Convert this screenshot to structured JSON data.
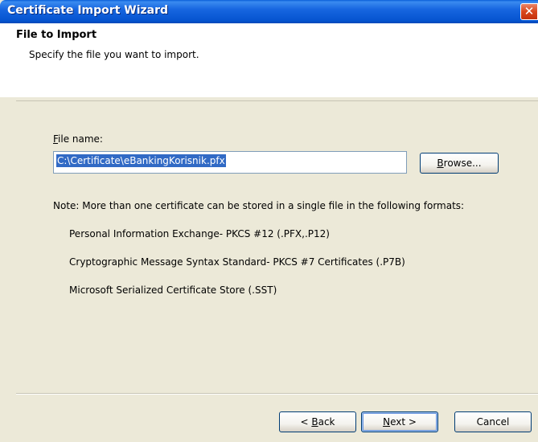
{
  "window": {
    "title": "Certificate Import Wizard",
    "close_glyph": "✕"
  },
  "header": {
    "title": "File to Import",
    "subtitle": "Specify the file you want to import."
  },
  "file_field": {
    "label_accel": "F",
    "label_rest": "ile name:",
    "value": "C:\\Certificate\\eBankingKorisnik.pfx"
  },
  "buttons": {
    "browse_accel": "B",
    "browse_rest": "rowse...",
    "back_prefix": "< ",
    "back_accel": "B",
    "back_rest": "ack",
    "next_accel": "N",
    "next_rest": "ext >",
    "cancel": "Cancel"
  },
  "note": {
    "text": "Note:  More than one certificate can be stored in a single file in the following formats:",
    "formats": [
      "Personal Information Exchange- PKCS #12 (.PFX,.P12)",
      "Cryptographic Message Syntax Standard- PKCS #7 Certificates (.P7B)",
      "Microsoft Serialized Certificate Store (.SST)"
    ]
  }
}
